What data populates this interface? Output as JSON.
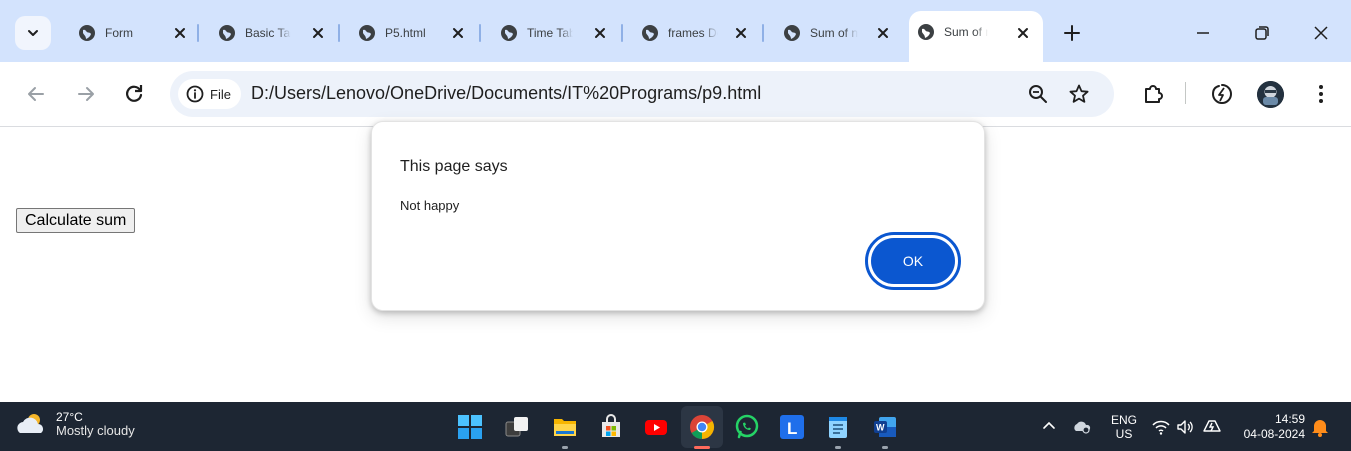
{
  "browser": {
    "tabs": [
      {
        "title": "Form"
      },
      {
        "title": "Basic Tags"
      },
      {
        "title": "P5.html"
      },
      {
        "title": "Time Table"
      },
      {
        "title": "frames Demo"
      },
      {
        "title": "Sum of numbers"
      },
      {
        "title": "Sum of numbers",
        "active": true
      }
    ],
    "chip_label": "File",
    "url": "D:/Users/Lenovo/OneDrive/Documents/IT%20Programs/p9.html"
  },
  "page": {
    "button_label": "Calculate sum"
  },
  "dialog": {
    "title": "This page says",
    "message": "Not happy",
    "ok_label": "OK"
  },
  "taskbar": {
    "weather_temp": "27°C",
    "weather_condition": "Mostly cloudy",
    "lang_top": "ENG",
    "lang_bottom": "US",
    "time": "14:59",
    "date": "04-08-2024"
  },
  "colors": {
    "tabstrip": "#d3e3fd",
    "accent": "#0b57d0",
    "taskbar": "#1d2633"
  }
}
